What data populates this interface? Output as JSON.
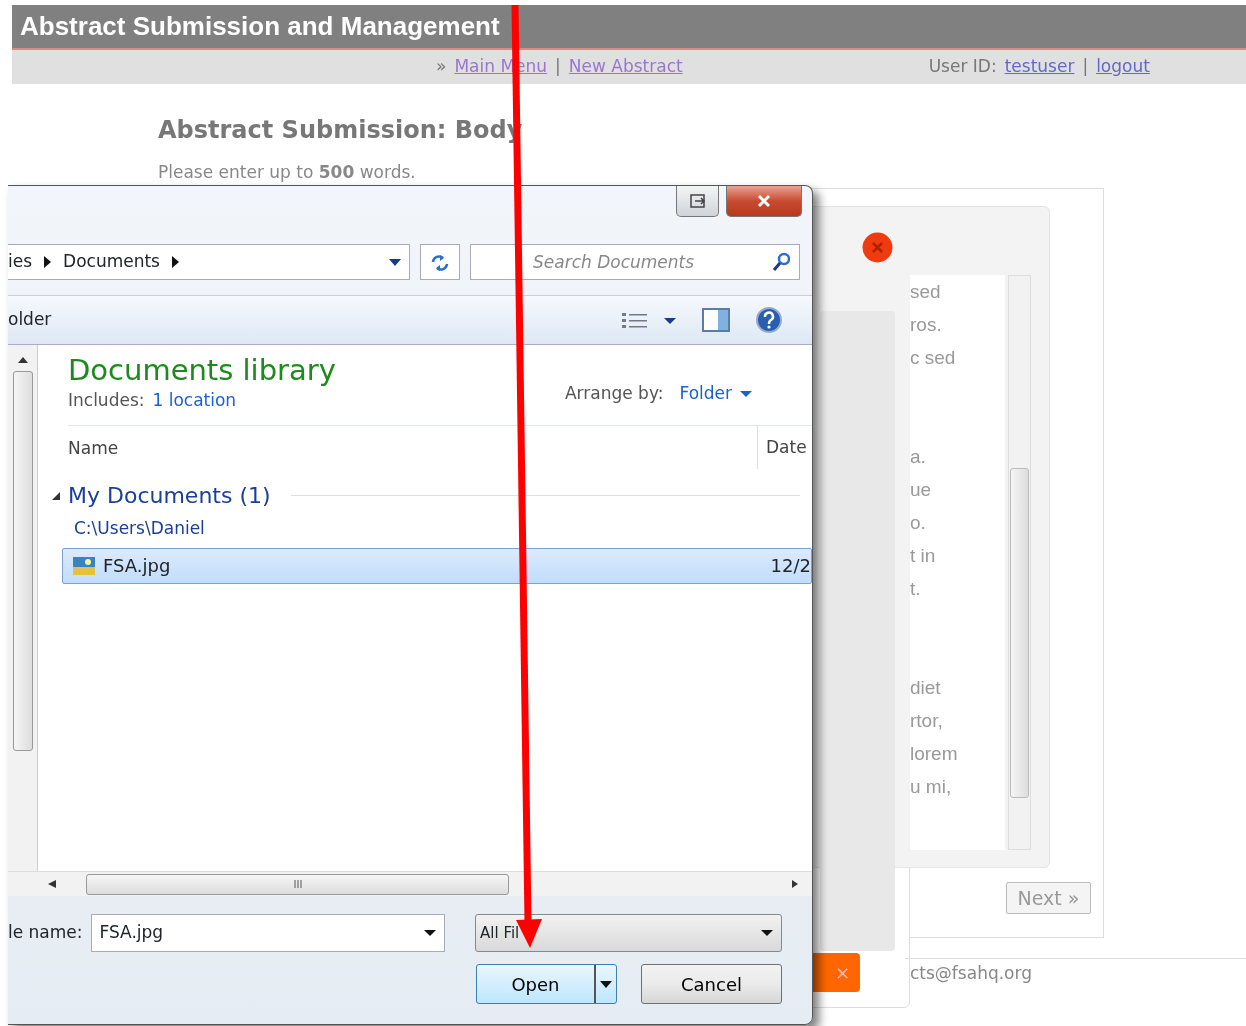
{
  "header": {
    "title": "Abstract Submission and Management"
  },
  "nav": {
    "prefix": "»",
    "links": [
      {
        "label": "Main Menu"
      },
      {
        "label": "New Abstract"
      }
    ],
    "separator": "|",
    "user_label": "User ID:",
    "user": "testuser",
    "user_separator": "|",
    "logout": "logout"
  },
  "page": {
    "heading": "Abstract Submission: Body",
    "instruction": "Please enter up to **500** words."
  },
  "background_modal": {
    "paragraphs": [
      [
        "sed",
        "ros.",
        "c sed"
      ],
      [
        "a.",
        "ue",
        "o.",
        "t in",
        "t."
      ],
      [
        "diet",
        "rtor,",
        "lorem",
        "u mi,"
      ]
    ],
    "next_button": "Next »",
    "footer_text": "cts@fsahq.org",
    "close_button": "×"
  },
  "dialog": {
    "breadcrumb": [
      "ies",
      "Documents"
    ],
    "search_placeholder": "Search Documents",
    "toolbar_label": "older",
    "library_title": "Documents library",
    "includes_label": "Includes:",
    "includes_link": "1 location",
    "arrange_label": "Arrange by:",
    "arrange_value": "Folder",
    "columns": [
      "Name",
      "Date"
    ],
    "groups": [
      {
        "title": "My Documents (1)",
        "expanded": true,
        "path": "C:\\Users\\Daniel",
        "files": [
          {
            "name": "FSA.jpg",
            "date": "12/2",
            "selected": true
          }
        ]
      }
    ],
    "filename_label": "le name:",
    "filename_value": "FSA.jpg",
    "filter": "All Fil",
    "open_button": "Open",
    "cancel_button": "Cancel"
  }
}
